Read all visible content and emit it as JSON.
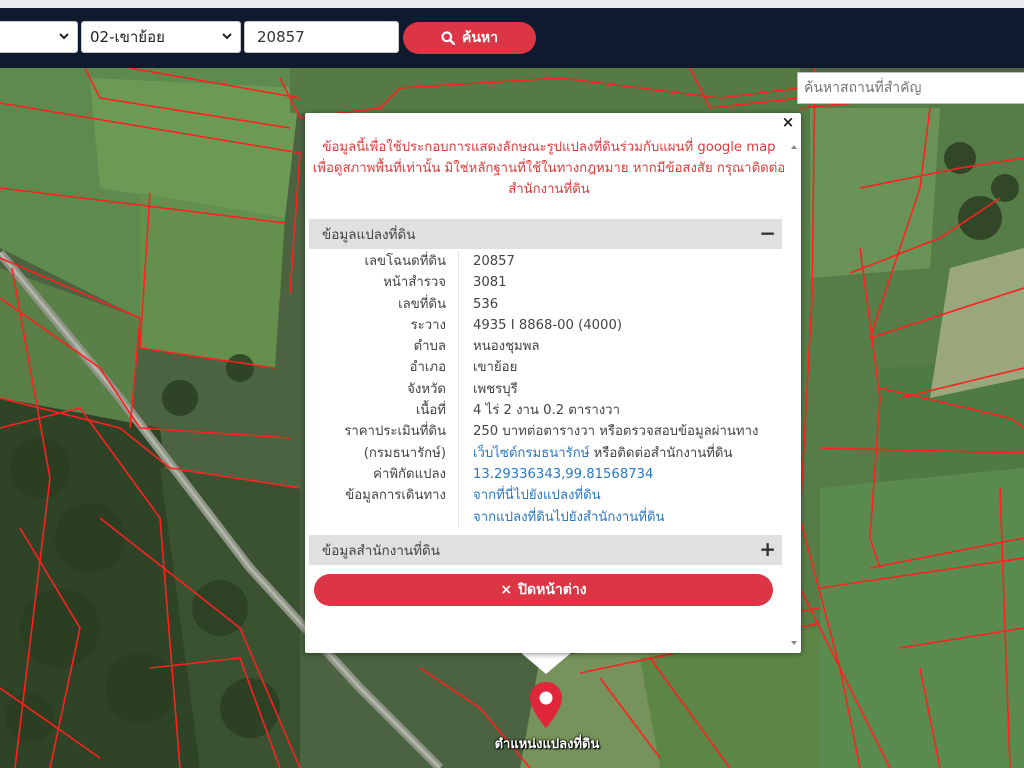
{
  "topbar": {
    "province_value": "",
    "district_value": "02-เขาย้อย",
    "parcel_value": "20857",
    "search_label": "ค้นหา"
  },
  "map": {
    "place_search_placeholder": "ค้นหาสถานที่สำคัญ",
    "marker_label": "ตำแหน่งแปลงที่ดิน"
  },
  "popup": {
    "disclaimer": "ข้อมูลนี้เพื่อใช้ประกอบการแสดงลักษณะรูปแปลงที่ดินร่วมกับแผนที่ google map เพื่อดูสภาพพื้นที่เท่านั้น มิใช่หลักฐานที่ใช้ในทางกฎหมาย หากมีข้อสงสัย กรุณาติดต่อสำนักงานที่ดิน",
    "close_symbol": "×",
    "parcel_section": {
      "title": "ข้อมูลแปลงที่ดิน",
      "toggle": "−"
    },
    "office_section": {
      "title": "ข้อมูลสำนักงานที่ดิน",
      "toggle": "+"
    },
    "rows": {
      "deed_no": {
        "label": "เลขโฉนดที่ดิน",
        "value": "20857"
      },
      "survey_page": {
        "label": "หน้าสำรวจ",
        "value": "3081"
      },
      "land_no": {
        "label": "เลขที่ดิน",
        "value": "536"
      },
      "ravang": {
        "label": "ระวาง",
        "value": "4935 I 8868-00 (4000)"
      },
      "tambon": {
        "label": "ตำบล",
        "value": "หนองชุมพล"
      },
      "amphoe": {
        "label": "อำเภอ",
        "value": "เขาย้อย"
      },
      "province": {
        "label": "จังหวัด",
        "value": "เพชรบุรี"
      },
      "area": {
        "label": "เนื้อที่",
        "value": "4 ไร่ 2 งาน 0.2 ตารางวา"
      },
      "appraisal": {
        "label": "ราคาประเมินที่ดิน",
        "value": "250 บาทต่อตารางวา หรือตรวจสอบข้อมูลผ่านทาง"
      },
      "treasury": {
        "label": "(กรมธนารักษ์)",
        "link": "เว็บไซต์กรมธนารักษ์",
        "suffix": " หรือติดต่อสำนักงานที่ดิน"
      },
      "coords": {
        "label": "ค่าพิกัดแปลง",
        "link": "13.29336343,99.81568734"
      },
      "travel": {
        "label": "ข้อมูลการเดินทาง",
        "link1": "จากที่นี่ไปยังแปลงที่ดิน",
        "link2": "จากแปลงที่ดินไปยังสำนักงานที่ดิน"
      }
    },
    "close_window_label": "ปิดหน้าต่าง",
    "close_window_icon": "×"
  },
  "colors": {
    "topbar_bg": "#0f1a2e",
    "accent_red": "#dc3545",
    "disclaimer_red": "#e03c3c",
    "link_blue": "#2a78c4",
    "parcel_lines": "#ff2020"
  },
  "icons": {
    "search": "search-icon",
    "map_marker": "map-marker-icon",
    "close": "close-icon",
    "chevron": "chevron-down-icon"
  }
}
